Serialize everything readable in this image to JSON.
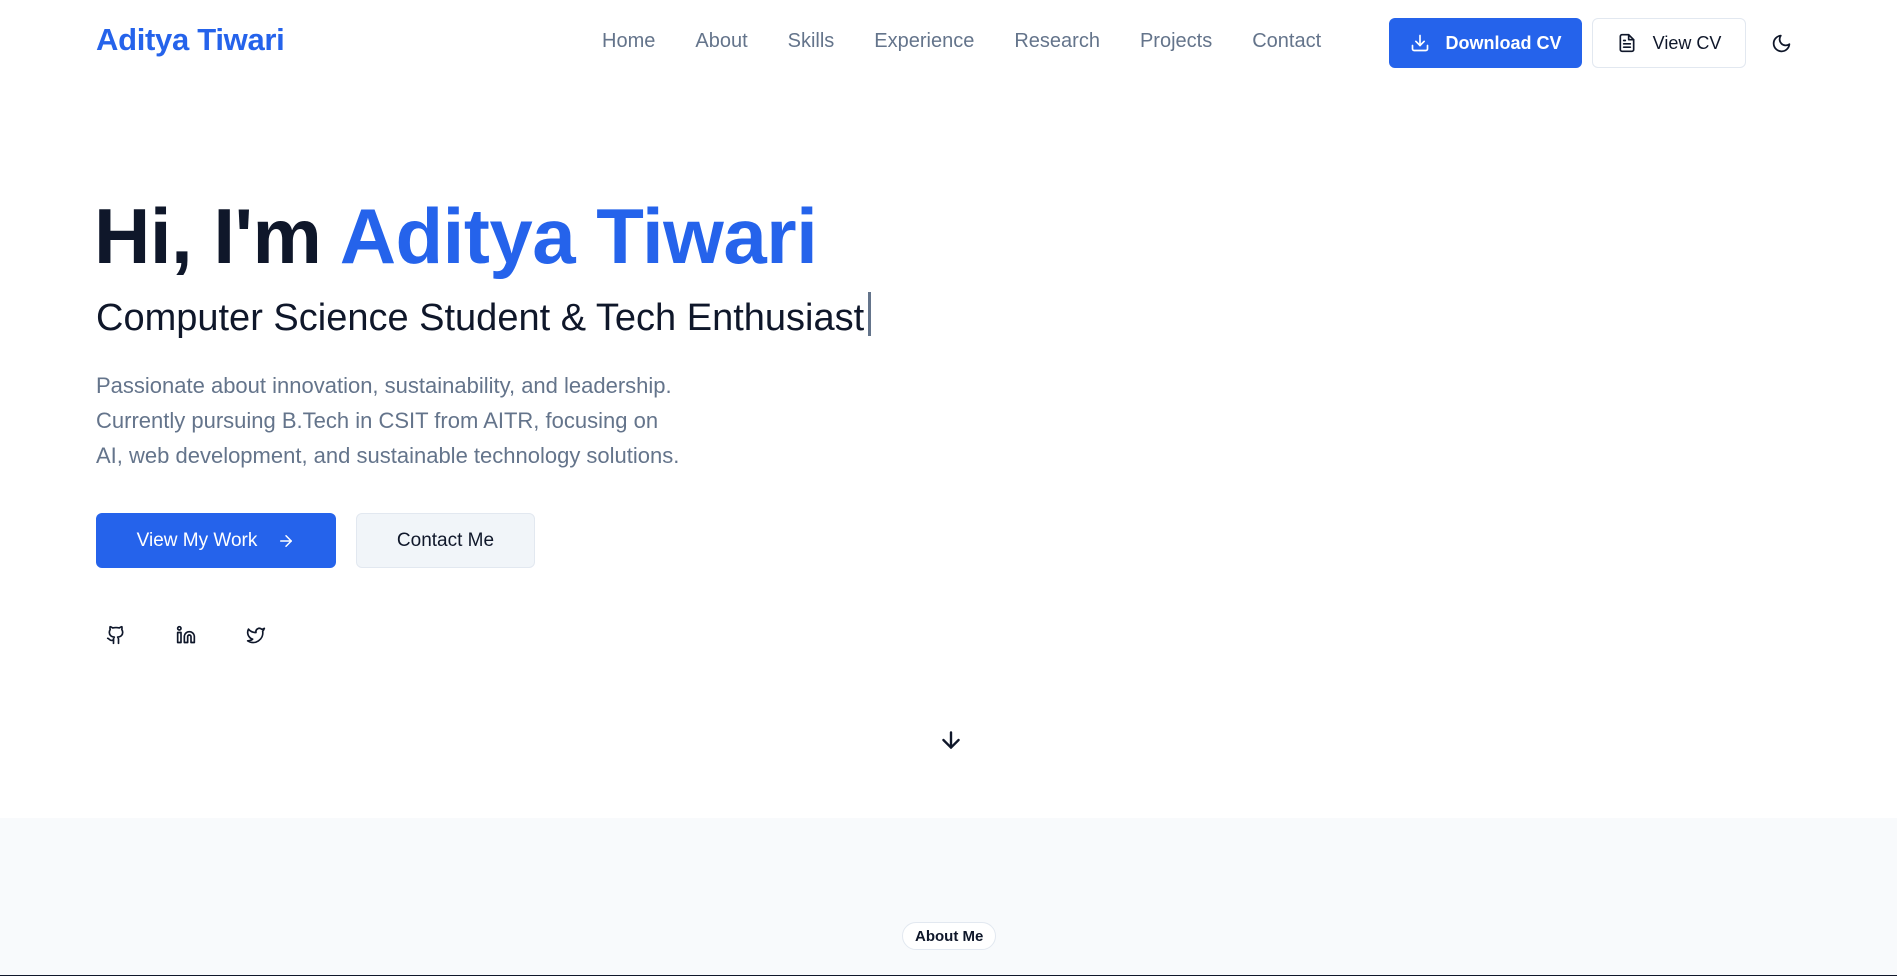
{
  "header": {
    "logo": "Aditya Tiwari",
    "nav": [
      {
        "label": "Home"
      },
      {
        "label": "About"
      },
      {
        "label": "Skills"
      },
      {
        "label": "Experience"
      },
      {
        "label": "Research"
      },
      {
        "label": "Projects"
      },
      {
        "label": "Contact"
      }
    ],
    "download_cv_label": "Download CV",
    "view_cv_label": "View CV",
    "theme_icon": "moon-icon"
  },
  "hero": {
    "greeting": "Hi, I'm ",
    "name": "Aditya Tiwari",
    "subtitle": "Computer Science Student & Tech Enthusiast",
    "description": [
      "Passionate about innovation, sustainability, and leadership.",
      "Currently pursuing B.Tech in CSIT from AITR, focusing on",
      "AI, web development, and sustainable technology solutions."
    ],
    "primary_button": "View My Work",
    "secondary_button": "Contact Me",
    "socials": [
      "github-icon",
      "linkedin-icon",
      "twitter-icon"
    ]
  },
  "about": {
    "badge": "About Me"
  },
  "colors": {
    "accent": "#2563eb",
    "text": "#0f172a",
    "muted": "#64748b",
    "section_bg": "#f8fafc"
  }
}
